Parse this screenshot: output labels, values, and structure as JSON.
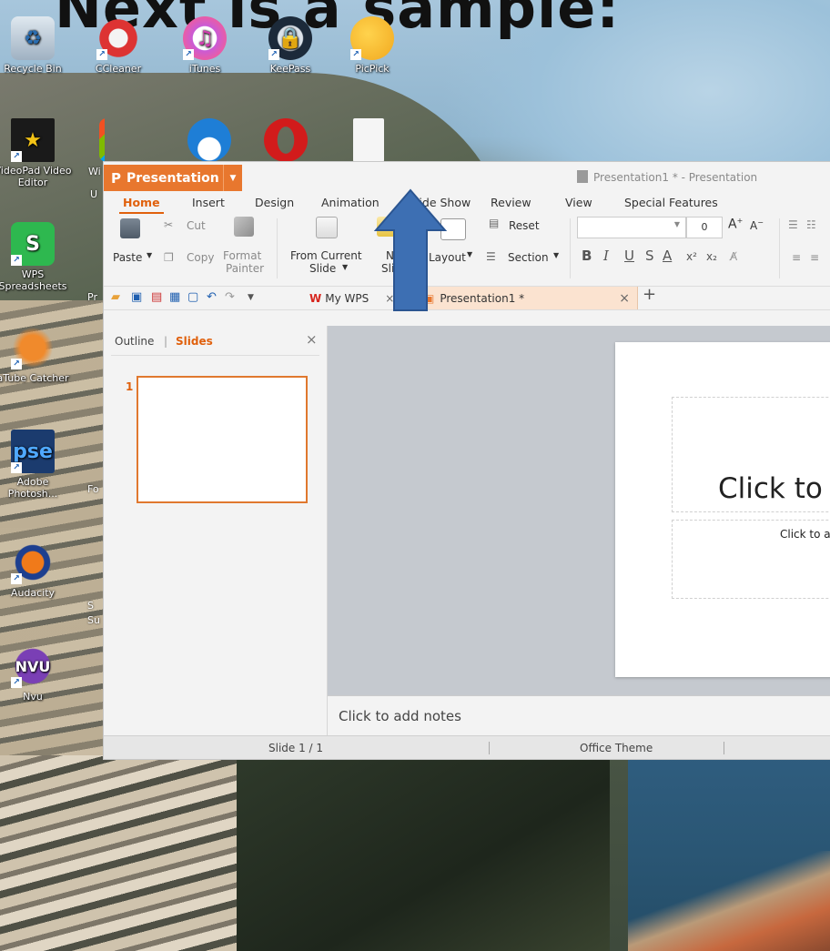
{
  "slide_heading": "Next is a sample:",
  "desktop_icons": [
    {
      "label": "Recycle Bin",
      "icon": "recycle-bin-icon"
    },
    {
      "label": "CCleaner",
      "icon": "ccleaner-icon"
    },
    {
      "label": "iTunes",
      "icon": "itunes-icon"
    },
    {
      "label": "KeePass",
      "icon": "keepass-icon"
    },
    {
      "label": "PicPick",
      "icon": "picpick-icon"
    },
    {
      "label": "VideoPad Video Editor",
      "icon": "videopad-icon"
    },
    {
      "label": "WPS Spreadsheets",
      "icon": "wps-spreadsheets-icon"
    },
    {
      "label": "aTube Catcher",
      "icon": "atube-catcher-icon"
    },
    {
      "label": "Adobe Photosh...",
      "icon": "photoshop-elements-icon"
    },
    {
      "label": "Audacity",
      "icon": "audacity-icon"
    },
    {
      "label": "Nvu",
      "icon": "nvu-icon"
    }
  ],
  "partial_labels": {
    "wi": "Wi",
    "u": "U",
    "pr": "Pr",
    "fo": "Fo",
    "su": "S\nSu"
  },
  "app": {
    "name": "Presentation",
    "window_title": "Presentation1 * - Presentation",
    "menu_tabs": [
      "Home",
      "Insert",
      "Design",
      "Animation",
      "Slide Show",
      "Review",
      "View",
      "Special Features"
    ],
    "active_tab": "Home",
    "ribbon": {
      "cut": "Cut",
      "paste": "Paste",
      "copy": "Copy",
      "format_painter_1": "Format",
      "format_painter_2": "Painter",
      "from_current_1": "From Current",
      "from_current_2": "Slide",
      "new_slide_1": "New",
      "new_slide_2": "Slide",
      "layout": "Layout",
      "reset": "Reset",
      "section": "Section",
      "font_size": "0"
    },
    "doc_tabs": [
      {
        "label": "My WPS"
      },
      {
        "label": "Presentation1 *"
      }
    ],
    "panel_tabs": {
      "outline": "Outline",
      "slides": "Slides",
      "divider": "|"
    },
    "thumb_number": "1",
    "slide_title_placeholder": "Click to",
    "slide_subtitle_placeholder": "Click to a",
    "notes_placeholder": "Click to add notes",
    "status": {
      "slide": "Slide 1 / 1",
      "theme": "Office Theme"
    }
  },
  "colors": {
    "accent": "#e8772e",
    "arrow": "#3d6fb3"
  }
}
